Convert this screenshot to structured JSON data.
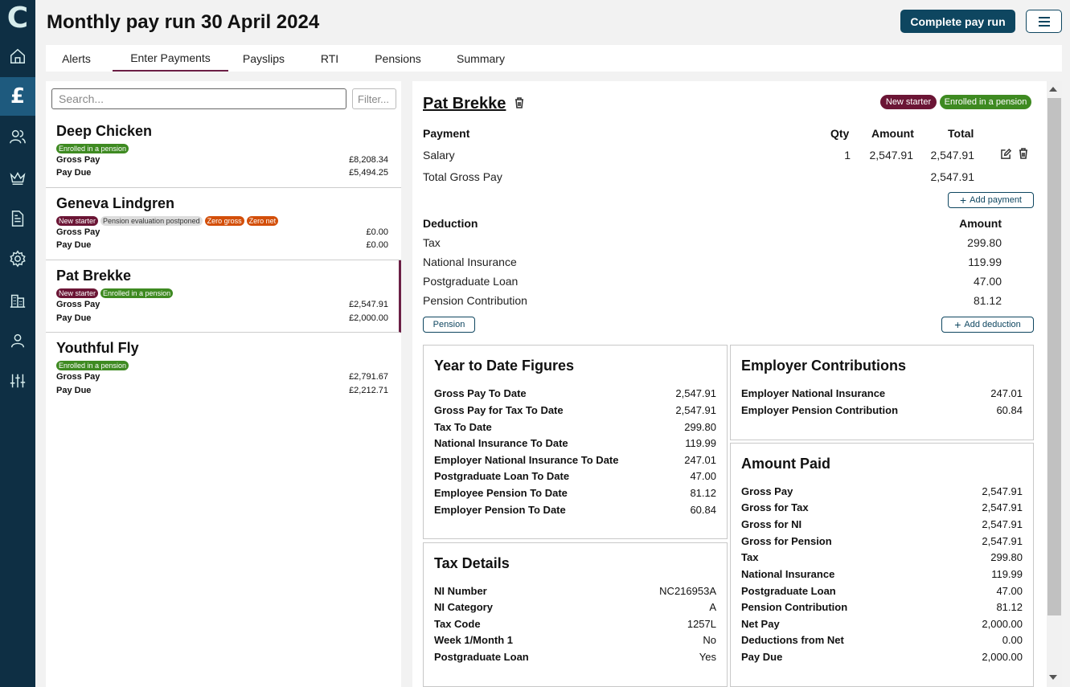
{
  "app": {
    "logo_letter": "C",
    "page_title": "Monthly pay run 30 April 2024",
    "complete_button": "Complete pay run"
  },
  "colors": {
    "sidebar": "#0e2f44",
    "primary": "#0e4660",
    "accent": "#6b1f45",
    "badge_green": "#3e8a21",
    "badge_maroon": "#6b1535",
    "badge_orange": "#d34f0a"
  },
  "sidebar": {
    "items": [
      {
        "icon": "home-icon"
      },
      {
        "icon": "pound-icon",
        "glyph": "£",
        "active": true
      },
      {
        "icon": "users-icon"
      },
      {
        "icon": "crown-icon"
      },
      {
        "icon": "document-icon"
      },
      {
        "icon": "gear-icon"
      },
      {
        "icon": "building-icon"
      },
      {
        "icon": "person-icon"
      },
      {
        "icon": "sliders-icon"
      }
    ]
  },
  "tabs": [
    {
      "label": "Alerts"
    },
    {
      "label": "Enter Payments",
      "active": true
    },
    {
      "label": "Payslips"
    },
    {
      "label": "RTI"
    },
    {
      "label": "Pensions"
    },
    {
      "label": "Summary"
    }
  ],
  "employee_list": {
    "search_placeholder": "Search...",
    "filter_placeholder": "Filter...",
    "gross_label": "Gross Pay",
    "due_label": "Pay Due",
    "employees": [
      {
        "name": "Deep Chicken",
        "badges": [
          {
            "text": "Enrolled in a pension",
            "kind": "green"
          }
        ],
        "gross": "£8,208.34",
        "due": "£5,494.25"
      },
      {
        "name": "Geneva Lindgren",
        "badges": [
          {
            "text": "New starter",
            "kind": "maroon"
          },
          {
            "text": "Pension evaluation postponed",
            "kind": "grey"
          },
          {
            "text": "Zero gross",
            "kind": "orange"
          },
          {
            "text": "Zero net",
            "kind": "orange"
          }
        ],
        "gross": "£0.00",
        "due": "£0.00"
      },
      {
        "name": "Pat Brekke",
        "badges": [
          {
            "text": "New starter",
            "kind": "maroon"
          },
          {
            "text": "Enrolled in a pension",
            "kind": "green"
          }
        ],
        "gross": "£2,547.91",
        "due": "£2,000.00",
        "selected": true
      },
      {
        "name": "Youthful Fly",
        "badges": [
          {
            "text": "Enrolled in a pension",
            "kind": "green"
          }
        ],
        "gross": "£2,791.67",
        "due": "£2,212.71"
      }
    ]
  },
  "detail": {
    "name": "Pat Brekke",
    "badges": [
      {
        "text": "New starter",
        "kind": "maroon"
      },
      {
        "text": "Enrolled in a pension",
        "kind": "green"
      }
    ],
    "payments": {
      "header": {
        "payment": "Payment",
        "qty": "Qty",
        "amount": "Amount",
        "total": "Total"
      },
      "rows": [
        {
          "name": "Salary",
          "qty": "1",
          "amount": "2,547.91",
          "total": "2,547.91"
        }
      ],
      "total_label": "Total Gross Pay",
      "total_value": "2,547.91",
      "add_button": "Add payment"
    },
    "deductions": {
      "header": {
        "deduction": "Deduction",
        "amount": "Amount"
      },
      "rows": [
        {
          "name": "Tax",
          "amount": "299.80"
        },
        {
          "name": "National Insurance",
          "amount": "119.99"
        },
        {
          "name": "Postgraduate Loan",
          "amount": "47.00"
        },
        {
          "name": "Pension Contribution",
          "amount": "81.12"
        }
      ],
      "pension_button": "Pension",
      "add_button": "Add deduction"
    },
    "ytd": {
      "title": "Year to Date Figures",
      "rows": [
        {
          "k": "Gross Pay To Date",
          "v": "2,547.91"
        },
        {
          "k": "Gross Pay for Tax To Date",
          "v": "2,547.91"
        },
        {
          "k": "Tax To Date",
          "v": "299.80"
        },
        {
          "k": "National Insurance To Date",
          "v": "119.99"
        },
        {
          "k": "Employer National Insurance To Date",
          "v": "247.01"
        },
        {
          "k": "Postgraduate Loan To Date",
          "v": "47.00"
        },
        {
          "k": "Employee Pension To Date",
          "v": "81.12"
        },
        {
          "k": "Employer Pension To Date",
          "v": "60.84"
        }
      ]
    },
    "employer": {
      "title": "Employer Contributions",
      "rows": [
        {
          "k": "Employer National Insurance",
          "v": "247.01"
        },
        {
          "k": "Employer Pension Contribution",
          "v": "60.84"
        }
      ]
    },
    "tax_details": {
      "title": "Tax Details",
      "rows": [
        {
          "k": "NI Number",
          "v": "NC216953A"
        },
        {
          "k": "NI Category",
          "v": "A"
        },
        {
          "k": "Tax Code",
          "v": "1257L"
        },
        {
          "k": "Week 1/Month 1",
          "v": "No"
        },
        {
          "k": "Postgraduate Loan",
          "v": "Yes"
        }
      ]
    },
    "amount_paid": {
      "title": "Amount Paid",
      "rows": [
        {
          "k": "Gross Pay",
          "v": "2,547.91"
        },
        {
          "k": "Gross for Tax",
          "v": "2,547.91"
        },
        {
          "k": "Gross for NI",
          "v": "2,547.91"
        },
        {
          "k": "Gross for Pension",
          "v": "2,547.91"
        },
        {
          "k": "Tax",
          "v": "299.80"
        },
        {
          "k": "National Insurance",
          "v": "119.99"
        },
        {
          "k": "Postgraduate Loan",
          "v": "47.00"
        },
        {
          "k": "Pension Contribution",
          "v": "81.12"
        },
        {
          "k": "Net Pay",
          "v": "2,000.00"
        },
        {
          "k": "Deductions from Net",
          "v": "0.00"
        },
        {
          "k": "Pay Due",
          "v": "2,000.00"
        }
      ]
    }
  }
}
